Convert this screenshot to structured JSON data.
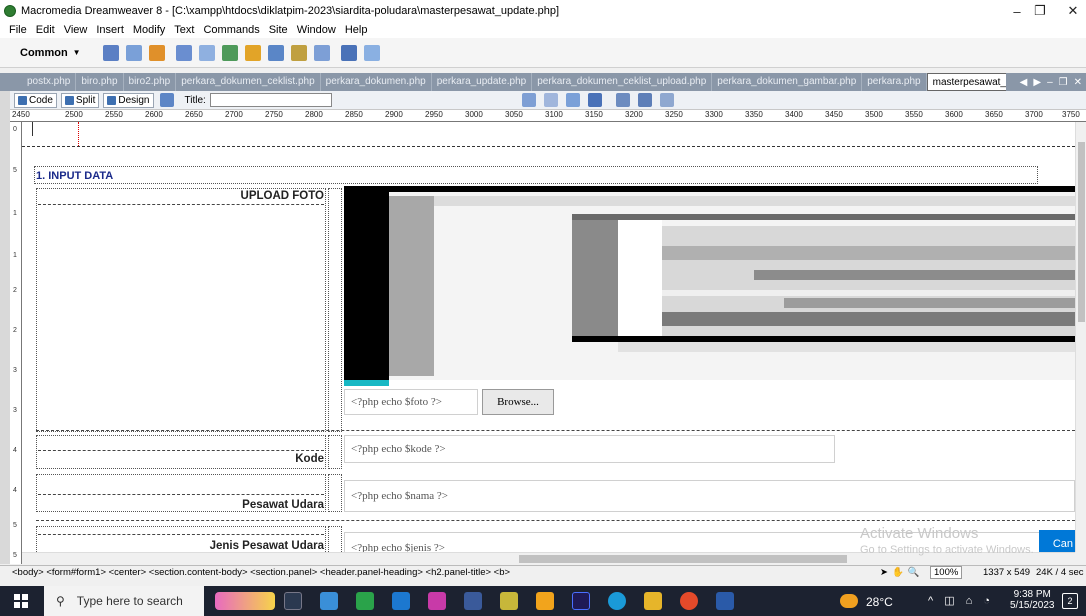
{
  "window": {
    "title": "Macromedia Dreamweaver 8 - [C:\\xampp\\htdocs\\diklatpim-2023\\siardita-poludara\\masterpesawat_update.php]",
    "minimize": "–",
    "maximize": "❐",
    "close": "✕"
  },
  "menu": [
    "File",
    "Edit",
    "View",
    "Insert",
    "Modify",
    "Text",
    "Commands",
    "Site",
    "Window",
    "Help"
  ],
  "insertbar": {
    "category": "Common"
  },
  "tabs": [
    "postx.php",
    "biro.php",
    "biro2.php",
    "perkara_dokumen_ceklist.php",
    "perkara_dokumen.php",
    "perkara_update.php",
    "perkara_dokumen_ceklist_upload.php",
    "perkara_dokumen_gambar.php",
    "perkara.php",
    "masterpesawat_update.php"
  ],
  "doc_toolbar": {
    "code": "Code",
    "split": "Split",
    "design": "Design",
    "title_label": "Title:",
    "title_value": ""
  },
  "ruler": [
    "2450",
    "2500",
    "2550",
    "2600",
    "2650",
    "2700",
    "2750",
    "2800",
    "2850",
    "2900",
    "2950",
    "3000",
    "3050",
    "3100",
    "3150",
    "3200",
    "3250",
    "3300",
    "3350",
    "3400",
    "3450",
    "3500",
    "3550",
    "3600",
    "3650",
    "3700",
    "3750"
  ],
  "vruler": [
    "0",
    "5",
    "1",
    "1",
    "2",
    "2",
    "3",
    "3",
    "4",
    "4",
    "5",
    "5"
  ],
  "form": {
    "section_title": "1. INPUT DATA",
    "upload_label": "UPLOAD FOTO",
    "foto_value": "<?php echo $foto ?>",
    "browse": "Browse...",
    "kode_label": "Kode",
    "kode_value": "<?php echo $kode ?>",
    "nama_label": "Pesawat Udara",
    "nama_value": "<?php echo $nama ?>",
    "jenis_label": "Jenis Pesawat Udara",
    "jenis_value": "<?php echo $jenis ?>",
    "cancel_btn": "Can"
  },
  "watermark": {
    "line1": "Activate Windows",
    "line2": "Go to Settings to activate Windows."
  },
  "status": {
    "tag_path": "<body> <form#form1> <center> <section.content-body> <section.panel> <header.panel-heading> <h2.panel-title> <b>",
    "zoom": "100%",
    "size": "1337 x 549",
    "download": "24K / 4 sec"
  },
  "taskbar": {
    "search_placeholder": "Type here to search",
    "weather": "28°C",
    "time": "9:38 PM",
    "date": "5/15/2023",
    "notif_count": "2"
  },
  "colors": {
    "tab_bg": "#8a97a8",
    "taskbar": "#1c2230",
    "accent": "#0078d7"
  }
}
